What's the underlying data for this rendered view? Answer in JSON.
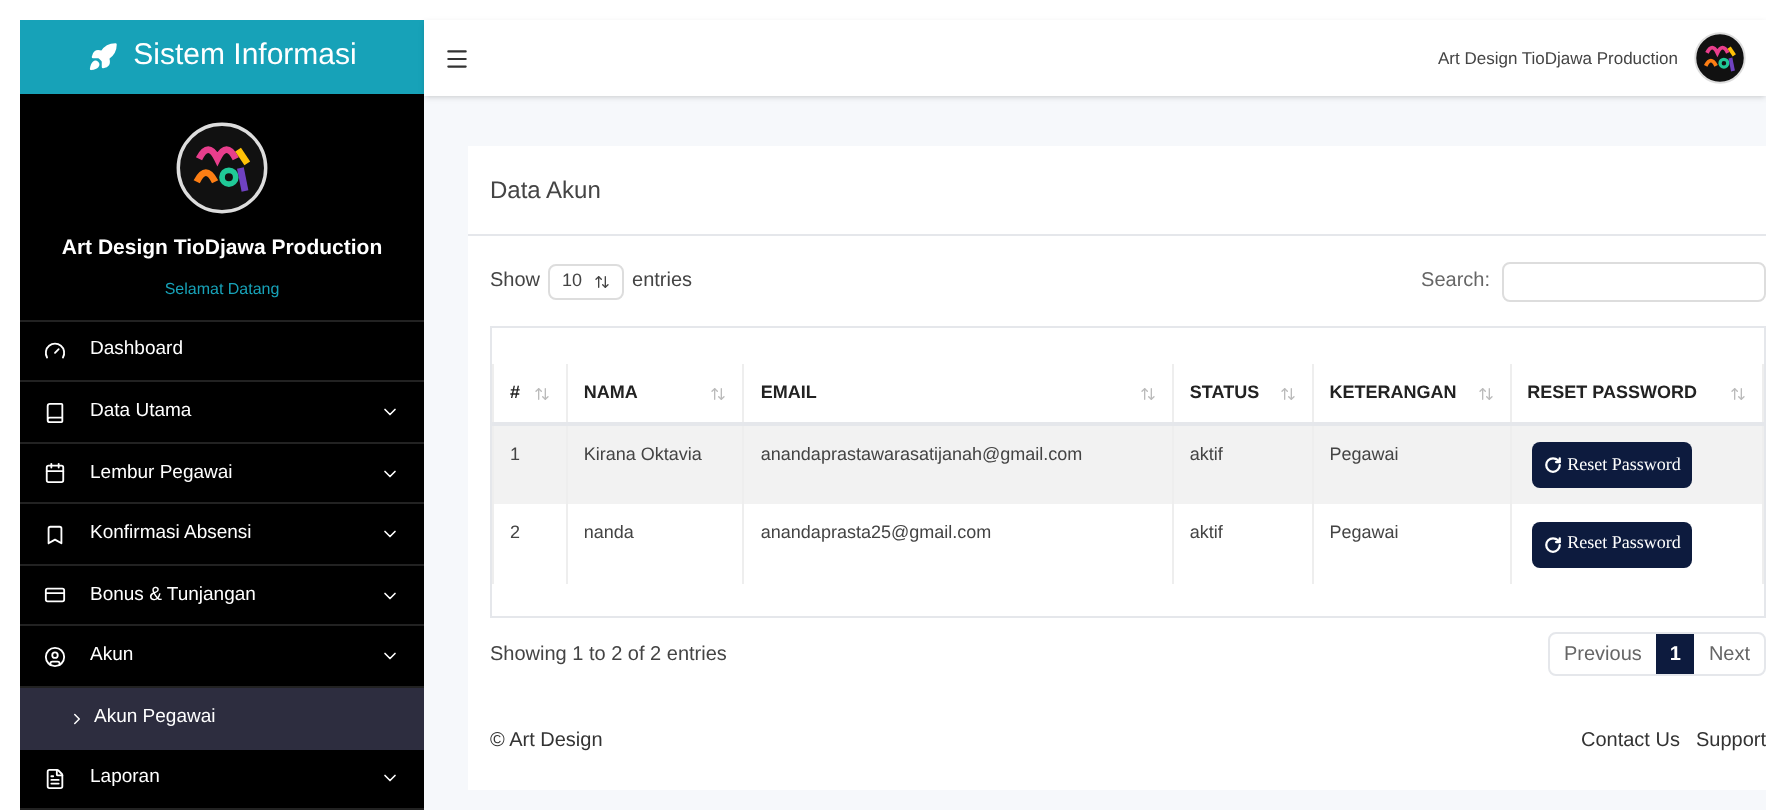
{
  "sidebar": {
    "brand": "Sistem Informasi",
    "profile": {
      "name": "Art Design TioDjawa Production",
      "greeting": "Selamat Datang"
    },
    "items": [
      {
        "label": "Dashboard",
        "expandable": false,
        "selected": false
      },
      {
        "label": "Data Utama",
        "expandable": true,
        "selected": false
      },
      {
        "label": "Lembur Pegawai",
        "expandable": true,
        "selected": false
      },
      {
        "label": "Konfirmasi Absensi",
        "expandable": true,
        "selected": false
      },
      {
        "label": "Bonus & Tunjangan",
        "expandable": true,
        "selected": false
      },
      {
        "label": "Akun",
        "expandable": true,
        "selected": false,
        "children": [
          {
            "label": "Akun Pegawai",
            "selected": true
          }
        ]
      },
      {
        "label": "Laporan",
        "expandable": true,
        "selected": false
      }
    ]
  },
  "topbar": {
    "user": "Art Design TioDjawa Production"
  },
  "card": {
    "title": "Data Akun",
    "show_label": "Show",
    "page_size": "10",
    "entries_label": "entries",
    "search_label": "Search:",
    "table": {
      "columns": [
        "#",
        "NAMA",
        "EMAIL",
        "STATUS",
        "KETERANGAN",
        "RESET PASSWORD"
      ],
      "rows": [
        {
          "cells": [
            "1",
            "Kirana Oktavia",
            "anandaprastawarasatijanah@gmail.com",
            "aktif",
            "Pegawai"
          ],
          "action": "Reset Password"
        },
        {
          "cells": [
            "2",
            "nanda",
            "anandaprasta25@gmail.com",
            "aktif",
            "Pegawai"
          ],
          "action": "Reset Password"
        }
      ]
    },
    "info": "Showing 1 to 2 of 2 entries",
    "pagination": [
      {
        "label": "Previous",
        "kind": "nav",
        "selected": false
      },
      {
        "label": "1",
        "kind": "page",
        "selected": true
      },
      {
        "label": "Next",
        "kind": "nav",
        "selected": false
      }
    ]
  },
  "footer": {
    "copyright": "© Art Design",
    "links": [
      "Contact Us",
      "Support"
    ]
  }
}
